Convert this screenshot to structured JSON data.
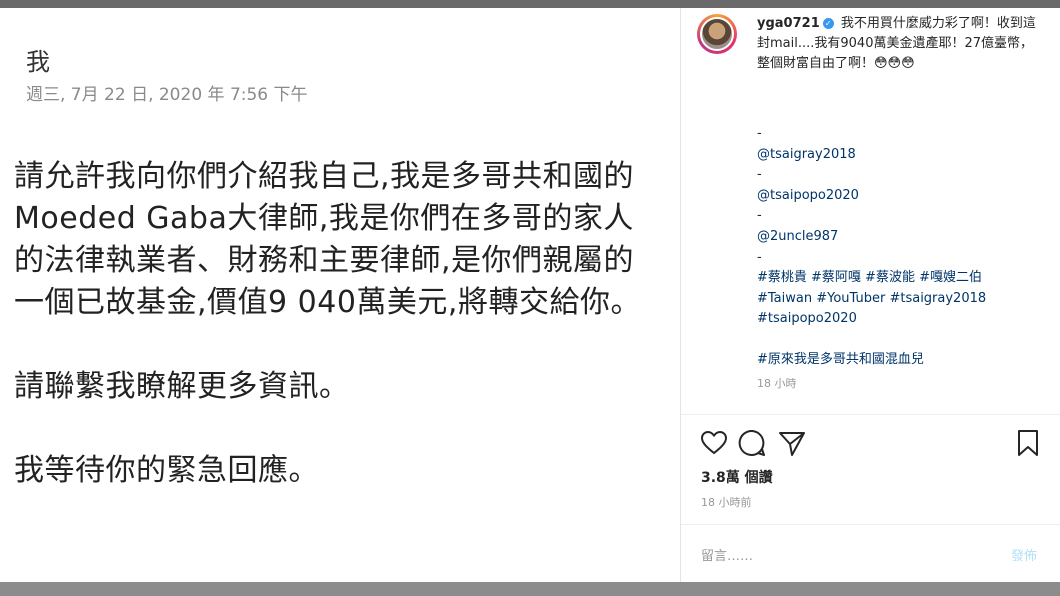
{
  "email": {
    "from": "我",
    "date": "週三, 7月 22 日, 2020 年 7:56 下午",
    "paragraphs": [
      "請允許我向你們介紹我自己,我是多哥共和國的Moeded Gaba大律師,我是你們在多哥的家人的法律執業者、財務和主要律師,是你們親屬的一個已故基金,價值9 040萬美元,將轉交給你。",
      "請聯繫我瞭解更多資訊。",
      "我等待你的緊急回應。"
    ]
  },
  "instagram": {
    "username": "yga0721",
    "caption": "我不用買什麼威力彩了啊！收到這封mail....我有9040萬美金遺產耶！27億臺幣，整個財富自由了啊！😳😳😳",
    "lines": [
      {
        "type": "dash",
        "text": "-"
      },
      {
        "type": "link",
        "text": "@tsaigray2018"
      },
      {
        "type": "dash",
        "text": "-"
      },
      {
        "type": "link",
        "text": "@tsaipopo2020"
      },
      {
        "type": "dash",
        "text": "-"
      },
      {
        "type": "link",
        "text": "@2uncle987"
      },
      {
        "type": "dash",
        "text": "-"
      }
    ],
    "hashtags": "#蔡桃貴 #蔡阿嘎 #蔡波能 #嘎嫂二伯 #Taiwan #YouTuber #tsaigray2018 #tsaipopo2020",
    "hashtag2": "#原來我是多哥共和國混血兒",
    "time_caption": "18 小時",
    "likes": "3.8萬 個讚",
    "time_post": "18 小時前",
    "comment_placeholder": "留言……",
    "post_label": "發佈",
    "icons": [
      "heart-icon",
      "comment-icon",
      "share-icon",
      "bookmark-icon"
    ]
  }
}
